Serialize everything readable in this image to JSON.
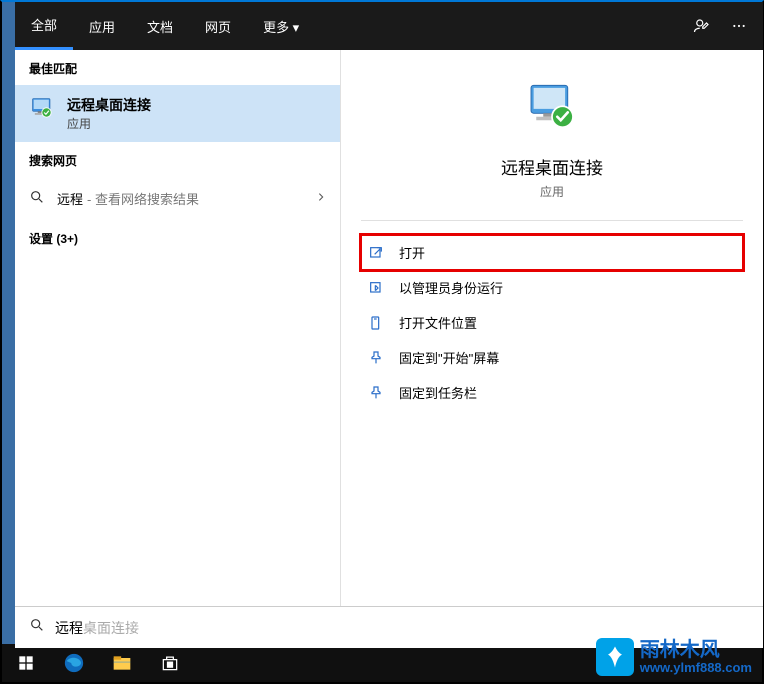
{
  "tabs": {
    "items": [
      {
        "label": "全部",
        "active": true
      },
      {
        "label": "应用",
        "active": false
      },
      {
        "label": "文档",
        "active": false
      },
      {
        "label": "网页",
        "active": false
      },
      {
        "label": "更多 ▾",
        "active": false
      }
    ]
  },
  "left": {
    "bestMatchHeader": "最佳匹配",
    "bestMatch": {
      "title": "远程桌面连接",
      "subtitle": "应用"
    },
    "webHeader": "搜索网页",
    "webItem": {
      "query": "远程",
      "hint": " - 查看网络搜索结果"
    },
    "settingsHeader": "设置 (3+)"
  },
  "preview": {
    "title": "远程桌面连接",
    "subtitle": "应用",
    "actions": [
      {
        "icon": "open",
        "label": "打开",
        "highlighted": true
      },
      {
        "icon": "admin",
        "label": "以管理员身份运行",
        "highlighted": false
      },
      {
        "icon": "folder",
        "label": "打开文件位置",
        "highlighted": false
      },
      {
        "icon": "pinstart",
        "label": "固定到\"开始\"屏幕",
        "highlighted": false
      },
      {
        "icon": "pintb",
        "label": "固定到任务栏",
        "highlighted": false
      }
    ]
  },
  "searchbox": {
    "typed": "远程",
    "completion": "桌面连接"
  },
  "watermark": {
    "cn": "雨林木风",
    "en": "www.ylmf888.com"
  }
}
